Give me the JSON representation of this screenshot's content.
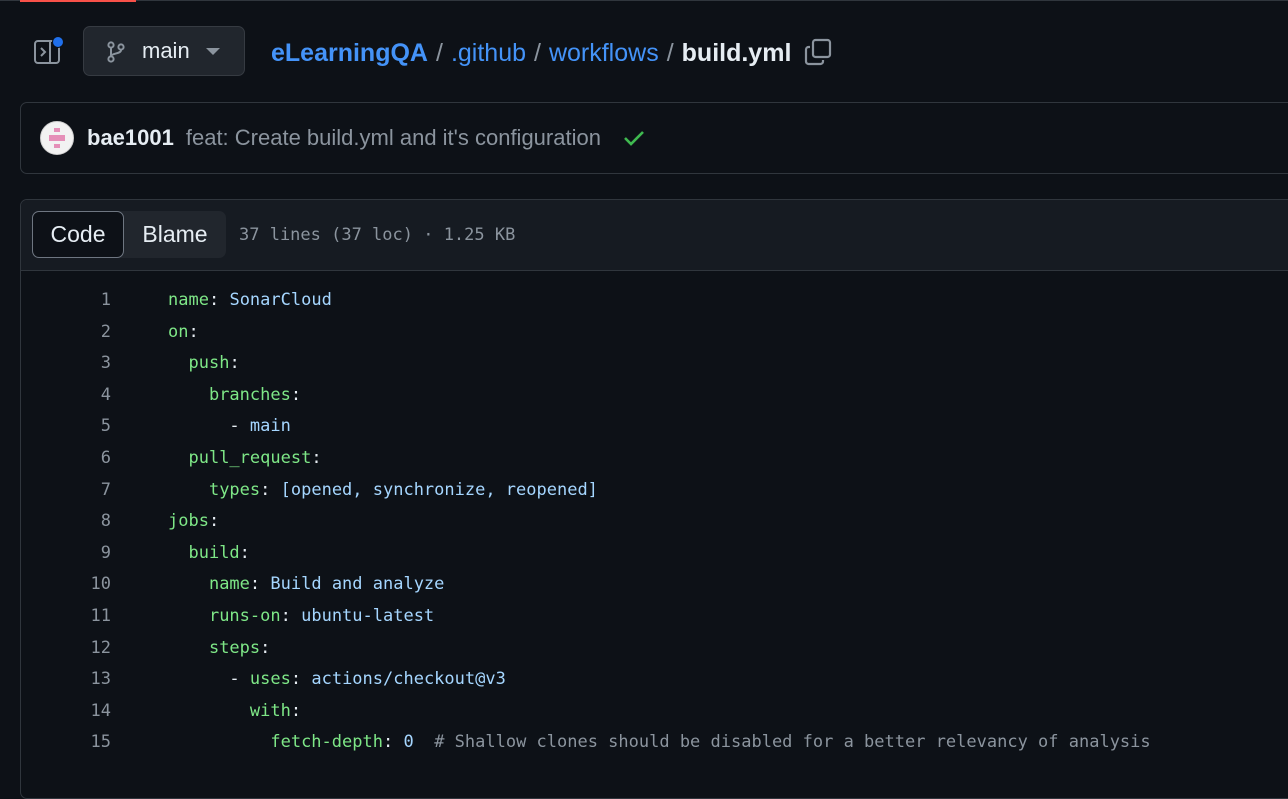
{
  "header": {
    "branch": "main",
    "breadcrumb": {
      "repo": "eLearningQA",
      "sep1": "/",
      "folder1": ".github",
      "sep2": "/",
      "folder2": "workflows",
      "sep3": "/",
      "file": "build.yml"
    }
  },
  "commit": {
    "author": "bae1001",
    "message": "feat: Create build.yml and it's configuration",
    "status": "success"
  },
  "file": {
    "tabs": {
      "code": "Code",
      "blame": "Blame"
    },
    "meta": "37 lines (37 loc) · 1.25 KB"
  },
  "code": {
    "lines": [
      {
        "num": "1",
        "indent": "",
        "dash": "",
        "key": "name",
        "value": "SonarCloud",
        "comment": ""
      },
      {
        "num": "2",
        "indent": "",
        "dash": "",
        "key": "on",
        "value": "",
        "comment": ""
      },
      {
        "num": "3",
        "indent": "  ",
        "dash": "",
        "key": "push",
        "value": "",
        "comment": ""
      },
      {
        "num": "4",
        "indent": "    ",
        "dash": "",
        "key": "branches",
        "value": "",
        "comment": ""
      },
      {
        "num": "5",
        "indent": "      ",
        "dash": "- ",
        "key": "",
        "value": "main",
        "comment": ""
      },
      {
        "num": "6",
        "indent": "  ",
        "dash": "",
        "key": "pull_request",
        "value": "",
        "comment": ""
      },
      {
        "num": "7",
        "indent": "    ",
        "dash": "",
        "key": "types",
        "value": "[opened, synchronize, reopened]",
        "comment": ""
      },
      {
        "num": "8",
        "indent": "",
        "dash": "",
        "key": "jobs",
        "value": "",
        "comment": ""
      },
      {
        "num": "9",
        "indent": "  ",
        "dash": "",
        "key": "build",
        "value": "",
        "comment": ""
      },
      {
        "num": "10",
        "indent": "    ",
        "dash": "",
        "key": "name",
        "value": "Build and analyze",
        "comment": ""
      },
      {
        "num": "11",
        "indent": "    ",
        "dash": "",
        "key": "runs-on",
        "value": "ubuntu-latest",
        "comment": ""
      },
      {
        "num": "12",
        "indent": "    ",
        "dash": "",
        "key": "steps",
        "value": "",
        "comment": ""
      },
      {
        "num": "13",
        "indent": "      ",
        "dash": "- ",
        "key": "uses",
        "value": "actions/checkout@v3",
        "comment": ""
      },
      {
        "num": "14",
        "indent": "        ",
        "dash": "",
        "key": "with",
        "value": "",
        "comment": ""
      },
      {
        "num": "15",
        "indent": "          ",
        "dash": "",
        "key": "fetch-depth",
        "value": "0",
        "comment": "# Shallow clones should be disabled for a better relevancy of analysis"
      }
    ]
  },
  "colors": {
    "background": "#0d1117",
    "link": "#4493f8",
    "yaml_key": "#7ee787",
    "yaml_value": "#a5d6ff",
    "success": "#3fb950"
  },
  "icons": [
    "sidebar-expand-icon",
    "git-branch-icon",
    "triangle-down-icon",
    "copy-icon",
    "check-icon"
  ]
}
